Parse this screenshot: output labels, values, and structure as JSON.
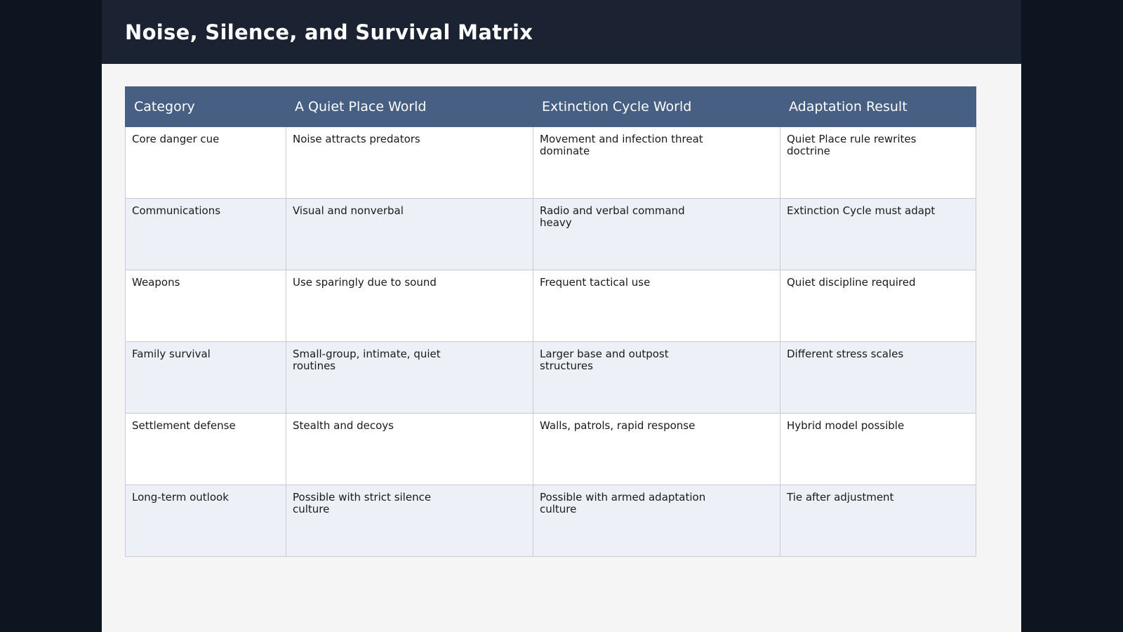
{
  "title": "Noise, Silence, and Survival Matrix",
  "table": {
    "headers": [
      "Category",
      "A Quiet Place World",
      "Extinction Cycle World",
      "Adaptation Result"
    ],
    "rows": [
      [
        "Core danger cue",
        "Noise attracts predators",
        "Movement and infection threat dominate",
        "Quiet Place rule rewrites doctrine"
      ],
      [
        "Communications",
        "Visual and nonverbal",
        "Radio and verbal command heavy",
        "Extinction Cycle must adapt"
      ],
      [
        "Weapons",
        "Use sparingly due to sound",
        "Frequent tactical use",
        "Quiet discipline required"
      ],
      [
        "Family survival",
        "Small-group, intimate, quiet routines",
        "Larger base and outpost structures",
        "Different stress scales"
      ],
      [
        "Settlement defense",
        "Stealth and decoys",
        "Walls, patrols, rapid response",
        "Hybrid model possible"
      ],
      [
        "Long-term outlook",
        "Possible with strict silence culture",
        "Possible with armed adaptation culture",
        "Tie after adjustment"
      ]
    ]
  },
  "colors": {
    "header_bg": "#1b2333",
    "table_header_bg": "#475f83",
    "row_alt_bg": "#edf0f6",
    "page_bg": "#f5f5f5"
  }
}
